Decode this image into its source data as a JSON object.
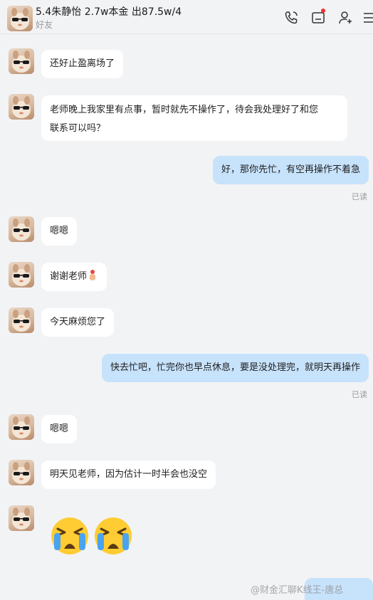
{
  "header": {
    "title": "5.4朱静怡 2.7w本金 出87.5w/4",
    "subtitle": "好友",
    "icons": [
      "phone-icon",
      "folder-icon",
      "add-friend-icon",
      "more-icon"
    ],
    "notification_color": "#f23030"
  },
  "messages": [
    {
      "side": "in",
      "text": "还好止盈离场了"
    },
    {
      "side": "in",
      "text": "老师晚上我家里有点事，暂时就先不操作了，待会我处理好了和您联系可以吗？",
      "line1": "老师晚上我家里有点事，暂时就先不操作了，待会我处理好了和您",
      "line2": "联系可以吗？"
    },
    {
      "side": "out",
      "text": "好，那你先忙，有空再操作不着急",
      "status": "已读"
    },
    {
      "side": "in",
      "text": "嗯嗯"
    },
    {
      "side": "in",
      "text": "谢谢老师",
      "emoji": "thanks-fist-icon"
    },
    {
      "side": "in",
      "text": "今天麻烦您了"
    },
    {
      "side": "out",
      "text": "快去忙吧，忙完你也早点休息，要是没处理完，就明天再操作",
      "status": "已读"
    },
    {
      "side": "in",
      "text": "嗯嗯"
    },
    {
      "side": "in",
      "text": "明天见老师，因为估计一时半会也没空"
    },
    {
      "side": "in",
      "emoji": [
        "crying-face-icon",
        "crying-face-icon"
      ]
    }
  ],
  "watermark": "@财金汇聊K线王-唐总",
  "colors": {
    "background": "#f2f3f5",
    "incoming_bubble": "#ffffff",
    "outgoing_bubble": "#c7e2fb"
  }
}
